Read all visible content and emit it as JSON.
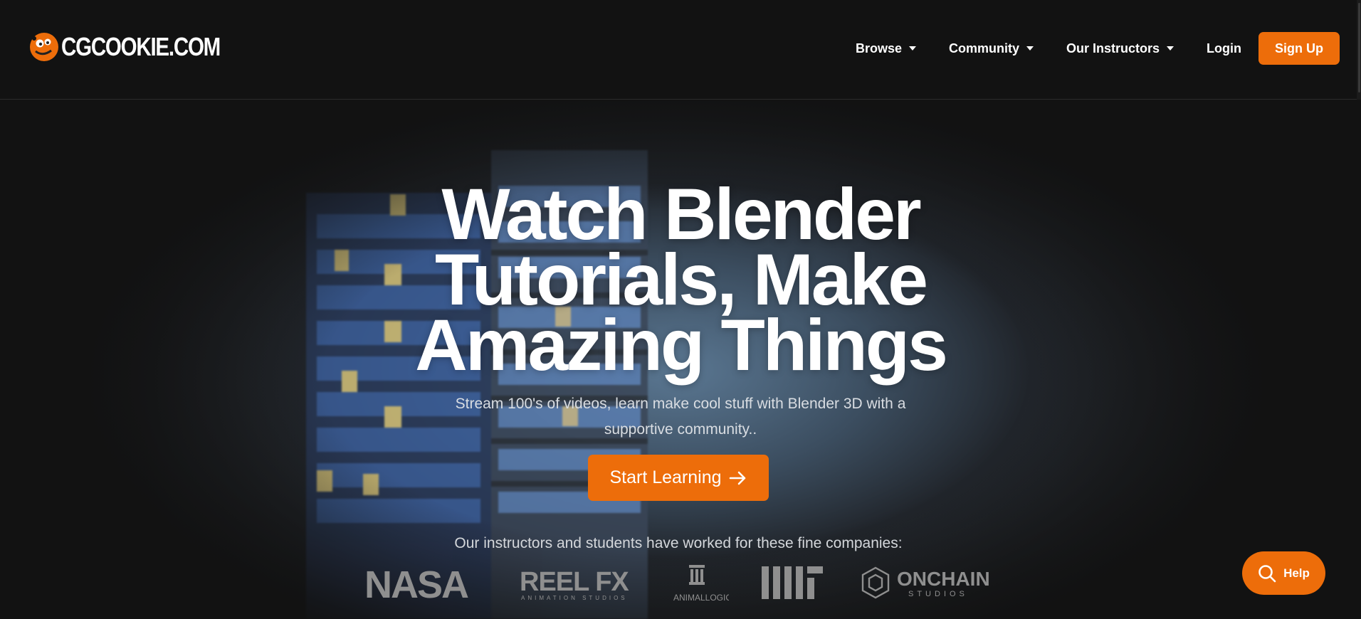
{
  "header": {
    "logo_text": "CGCOOKIE.COM",
    "nav": [
      {
        "label": "Browse",
        "has_dropdown": true
      },
      {
        "label": "Community",
        "has_dropdown": true
      },
      {
        "label": "Our Instructors",
        "has_dropdown": true
      }
    ],
    "login_label": "Login",
    "signup_label": "Sign Up"
  },
  "hero": {
    "title_lines": [
      "Watch Blender",
      "Tutorials, Make",
      "Amazing Things"
    ],
    "subtitle": "Stream 100's of videos, learn make cool stuff with Blender 3D with a supportive community..",
    "cta_label": "Start Learning",
    "companies_label": "Our instructors and students have worked for these fine companies:",
    "companies": [
      {
        "name": "NASA"
      },
      {
        "name": "REEL FX",
        "tagline": "ANIMATION STUDIOS"
      },
      {
        "name": "ANIMALLOGIC"
      },
      {
        "name": "MIT"
      },
      {
        "name": "ONCHAIN",
        "tagline": "STUDIOS"
      }
    ]
  },
  "help": {
    "label": "Help"
  },
  "colors": {
    "accent": "#ed6d0a",
    "background": "#121212",
    "text": "#ffffff"
  },
  "icons": [
    "cookie-logo-icon",
    "chevron-down-icon",
    "arrow-right-icon",
    "search-icon"
  ]
}
